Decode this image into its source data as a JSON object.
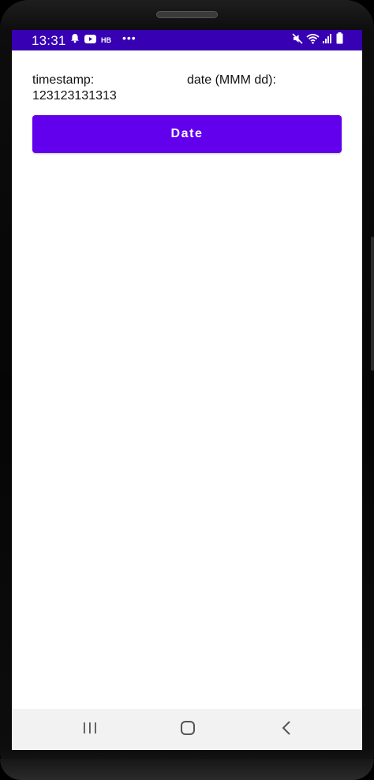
{
  "status_bar": {
    "time": "13:31",
    "left_icons": [
      "bell-icon",
      "youtube-icon"
    ],
    "carrier_badge": "HB",
    "more_indicator": "•••",
    "right_icons": [
      "mute-icon",
      "wifi-icon",
      "signal-icon",
      "battery-icon"
    ],
    "color": "#3700b3"
  },
  "main": {
    "timestamp_label": "timestamp:",
    "timestamp_value": "123123131313",
    "date_label": "date (MMM dd):",
    "date_button_label": "Date",
    "button_color": "#6200ee"
  },
  "nav_bar": {
    "items": [
      "recents-icon",
      "home-icon",
      "back-icon"
    ]
  }
}
